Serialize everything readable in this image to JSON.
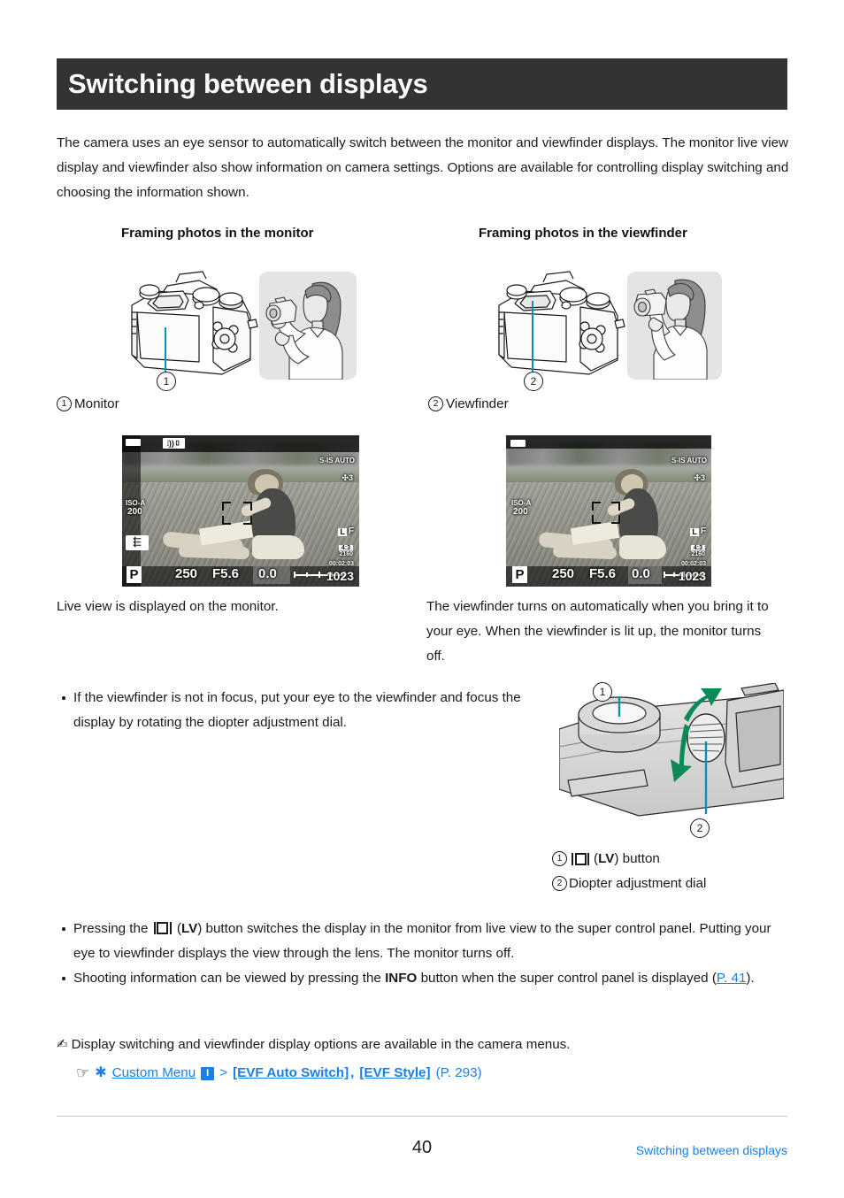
{
  "header": {
    "title": "Switching between displays"
  },
  "intro": "The camera uses an eye sensor to automatically switch between the monitor and viewfinder displays. The monitor live view display and viewfinder also show information on camera settings. Options are available for controlling display switching and choosing the information shown.",
  "columns": [
    {
      "heading": "Framing photos in the monitor",
      "callout_number": "1",
      "callout_label": "Monitor",
      "caption": "Live view is displayed on the monitor."
    },
    {
      "heading": "Framing photos in the viewfinder",
      "callout_number": "2",
      "callout_label": "Viewfinder",
      "caption": "The viewfinder turns on automatically when you bring it to your eye. When the viewfinder is lit up, the monitor turns off."
    }
  ],
  "live_view_osd": {
    "battery": "",
    "wifi_icon": "wifi-icon",
    "stabilizer": "S-IS AUTO",
    "picture_mode": "3",
    "iso_label": "ISO-A",
    "iso_value": "200",
    "drive_icon": "drive-mode-icon",
    "image_size": "L",
    "image_quality": "F",
    "aspect_label": "4:3",
    "card_value": "2160",
    "mode": "P",
    "shutter": "250",
    "aperture": "F5.6",
    "exposure_comp": "0.0",
    "record_time": "00:02:03",
    "shots_remaining": "1023"
  },
  "bullet_focus": "If the viewfinder is not in focus, put your eye to the viewfinder and focus the display by rotating the diopter adjustment dial.",
  "diopter_legend": [
    {
      "num": "1",
      "pre": "",
      "glyph": "lv-button-icon",
      "bold": "LV",
      "post": ") button",
      "paren_open": "("
    },
    {
      "num": "2",
      "text": "Diopter adjustment dial"
    }
  ],
  "bullets": [
    {
      "part1": "Pressing the ",
      "glyph": "lv-button-icon",
      "part2_paren_open": " (",
      "bold": "LV",
      "part3": ") button switches the display in the monitor from live view to the super control panel. Putting your eye to viewfinder displays the view through the lens. The monitor turns off."
    },
    {
      "part1": "Shooting information can be viewed by pressing the ",
      "bold": "INFO",
      "part2": " button when the super control panel is displayed (",
      "link": "P. 41",
      "part3": ")."
    }
  ],
  "tip": {
    "icon": "bulb-icon",
    "text": "Display switching and viewfinder display options are available in the camera menus.",
    "hand_icon": "pointing-hand-icon",
    "gear_icon": "gear-icon",
    "menu_label": "Custom Menu",
    "tab": "I",
    "separator": ">",
    "item1": "[EVF Auto Switch]",
    "comma": ",",
    "item2": "[EVF Style]",
    "page_ref": "(P. 293)"
  },
  "footer": {
    "page_number": "40",
    "section": "Switching between displays"
  },
  "colors": {
    "header_bg": "#333333",
    "link": "#1a7fe8",
    "leader_line": "#0d8fb3",
    "arrow_green": "#0b8a57",
    "thumb_bg": "#e4e4e4"
  }
}
